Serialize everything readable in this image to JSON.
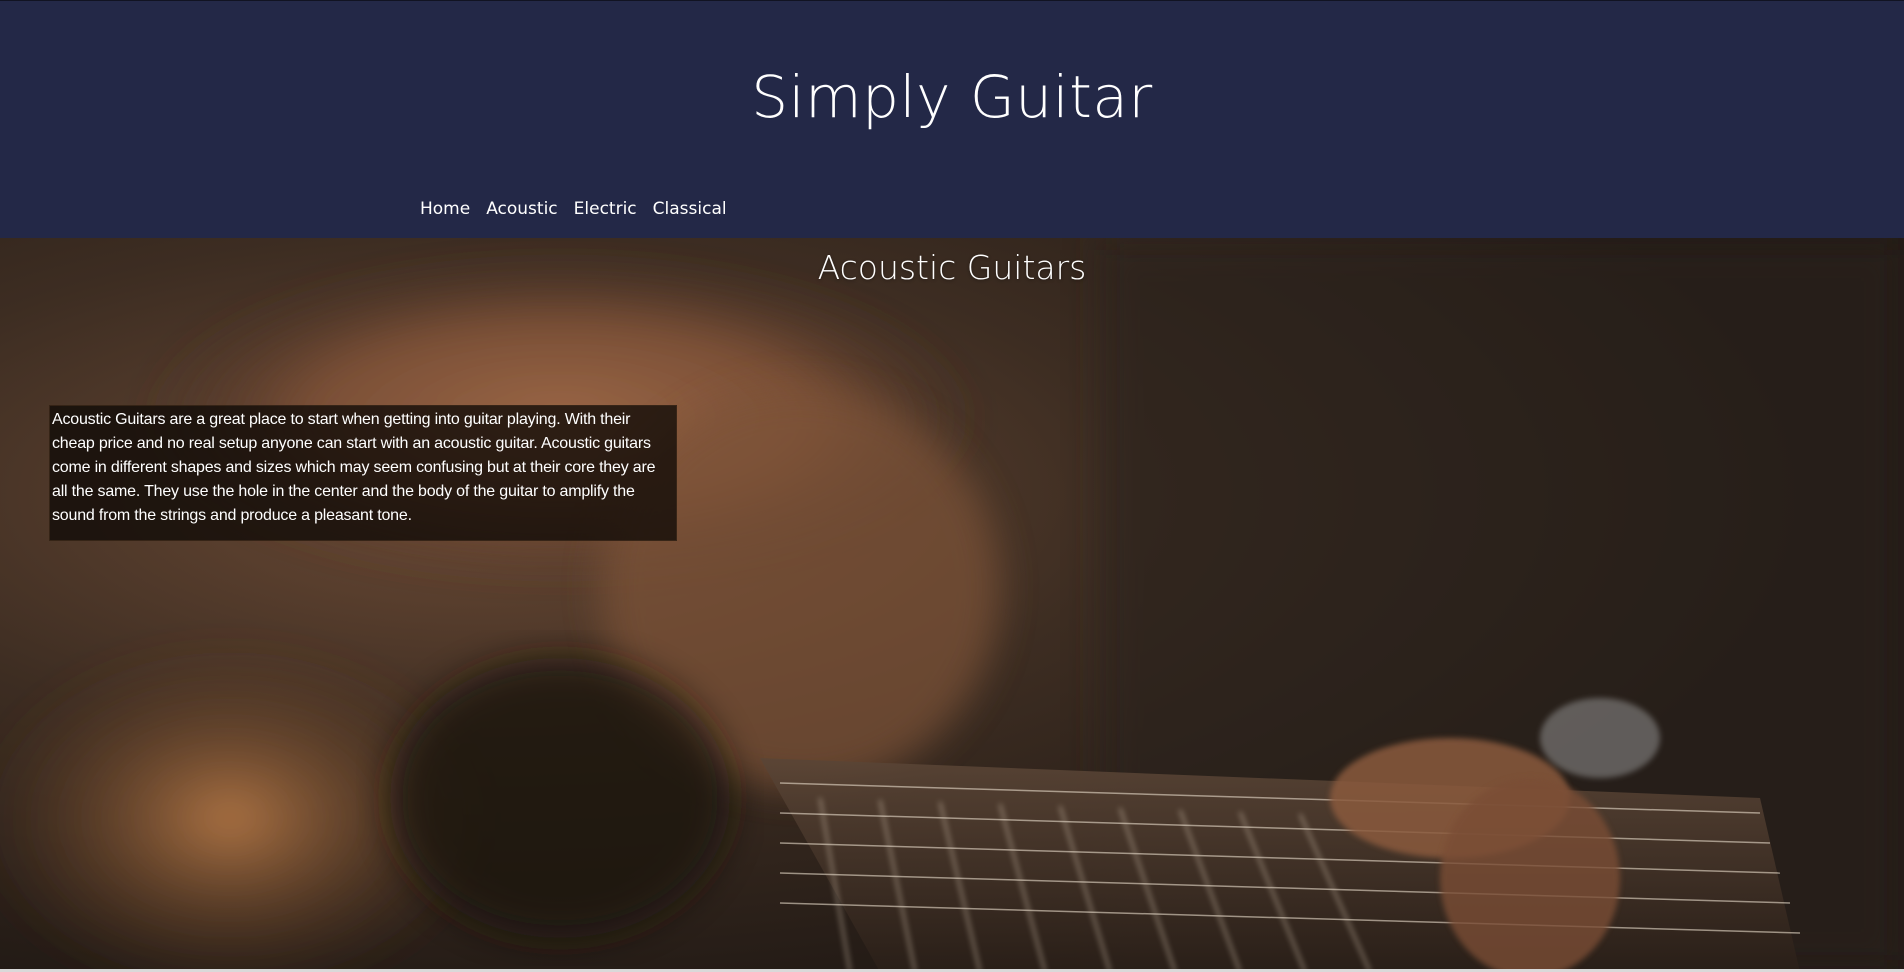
{
  "header": {
    "title": "Simply Guitar",
    "nav": [
      {
        "label": "Home"
      },
      {
        "label": "Acoustic"
      },
      {
        "label": "Electric"
      },
      {
        "label": "Classical"
      }
    ]
  },
  "main": {
    "heading": "Acoustic Guitars",
    "description": "Acoustic Guitars are a great place to start when getting into guitar playing. With their cheap price and no real setup anyone can start with an acoustic guitar. Acoustic guitars come in different shapes and sizes which may seem confusing but at their core they are all the same. They use the hole in the center and the body of the guitar to amplify the sound from the strings and produce a pleasant tone.",
    "background_image": "acoustic-guitar-photo"
  },
  "colors": {
    "header_bg": "#232847",
    "text": "#ffffff",
    "hero_tone": "#3a2a1f"
  }
}
